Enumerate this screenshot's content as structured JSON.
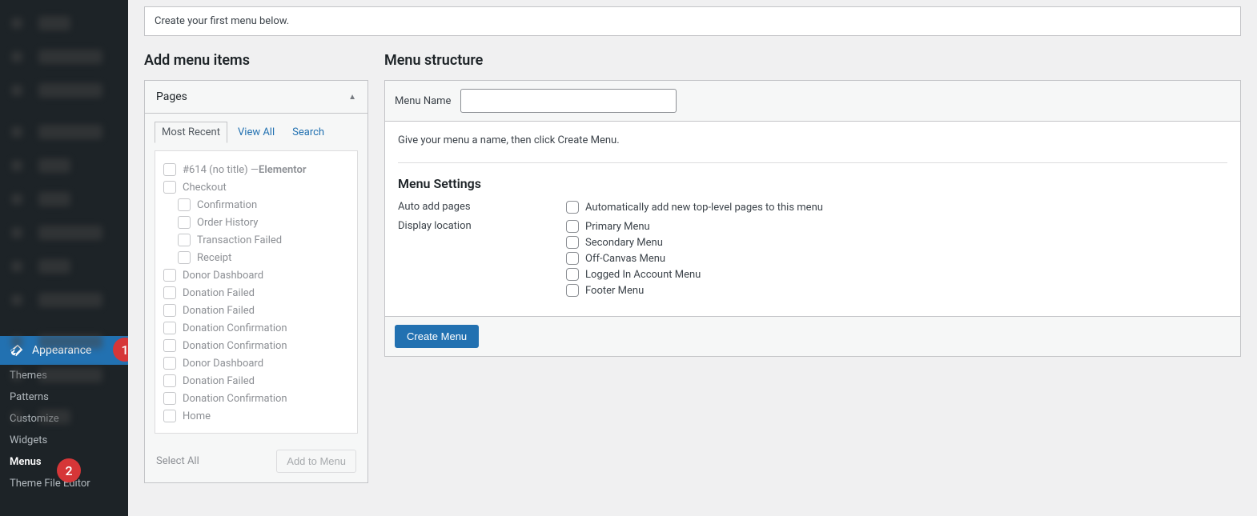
{
  "notice": "Create your first menu below.",
  "sidebar": {
    "appearance": "Appearance",
    "submenu": {
      "themes": "Themes",
      "patterns": "Patterns",
      "customize": "Customize",
      "widgets": "Widgets",
      "menus": "Menus",
      "theme_file_editor": "Theme File Editor"
    }
  },
  "badges": {
    "one": "1",
    "two": "2"
  },
  "left": {
    "heading": "Add menu items",
    "metabox_title": "Pages",
    "tabs": {
      "recent": "Most Recent",
      "view_all": "View All",
      "search": "Search"
    },
    "pages": [
      {
        "label": "#614 (no title) — ",
        "suffix": "Elementor",
        "indent": false
      },
      {
        "label": "Checkout",
        "indent": false
      },
      {
        "label": "Confirmation",
        "indent": true
      },
      {
        "label": "Order History",
        "indent": true
      },
      {
        "label": "Transaction Failed",
        "indent": true
      },
      {
        "label": "Receipt",
        "indent": true
      },
      {
        "label": "Donor Dashboard",
        "indent": false
      },
      {
        "label": "Donation Failed",
        "indent": false
      },
      {
        "label": "Donation Failed",
        "indent": false
      },
      {
        "label": "Donation Confirmation",
        "indent": false
      },
      {
        "label": "Donation Confirmation",
        "indent": false
      },
      {
        "label": "Donor Dashboard",
        "indent": false
      },
      {
        "label": "Donation Failed",
        "indent": false
      },
      {
        "label": "Donation Confirmation",
        "indent": false
      },
      {
        "label": "Home",
        "indent": false
      }
    ],
    "select_all": "Select All",
    "add_to_menu": "Add to Menu"
  },
  "right": {
    "heading": "Menu structure",
    "menu_name_label": "Menu Name",
    "menu_name_value": "",
    "hint": "Give your menu a name, then click Create Menu.",
    "settings_heading": "Menu Settings",
    "auto_add_label": "Auto add pages",
    "auto_add_opt": "Automatically add new top-level pages to this menu",
    "display_loc_label": "Display location",
    "locations": [
      "Primary Menu",
      "Secondary Menu",
      "Off-Canvas Menu",
      "Logged In Account Menu",
      "Footer Menu"
    ],
    "create_btn": "Create Menu"
  }
}
